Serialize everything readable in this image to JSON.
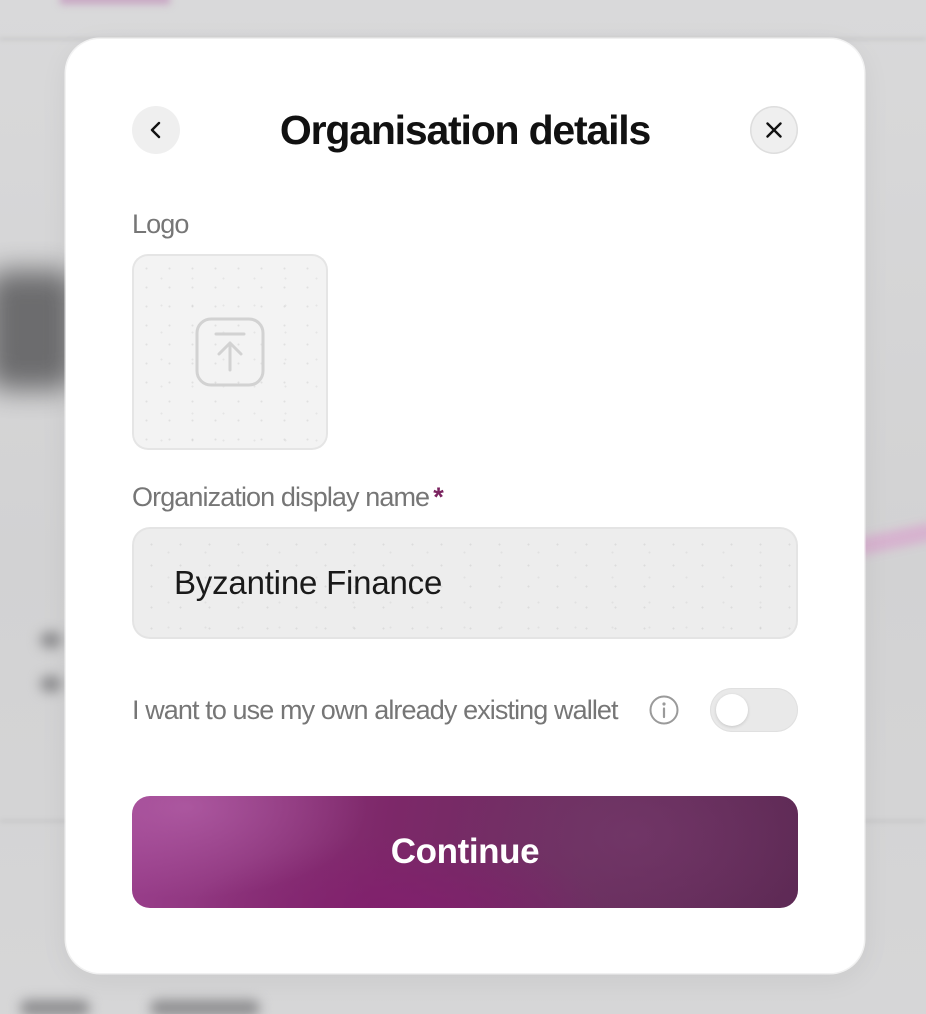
{
  "modal": {
    "title": "Organisation details",
    "back_icon": "chevron-left-icon",
    "close_icon": "close-icon"
  },
  "logo": {
    "label": "Logo",
    "upload_icon": "upload-icon"
  },
  "org_name": {
    "label": "Organization display name",
    "required_mark": "*",
    "value": "Byzantine Finance"
  },
  "wallet": {
    "label": "I want to use my own already existing wallet",
    "info_icon": "info-icon",
    "toggle_on": false
  },
  "actions": {
    "continue_label": "Continue"
  },
  "colors": {
    "accent": "#7b2460",
    "button_start": "#9a3f8c",
    "button_end": "#5e2a55"
  }
}
